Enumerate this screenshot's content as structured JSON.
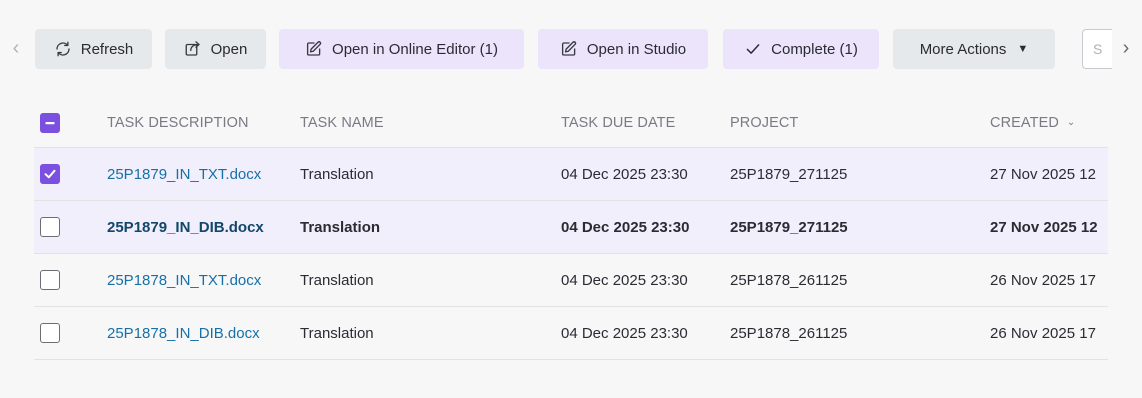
{
  "toolbar": {
    "nav_prev": "‹",
    "nav_next": "›",
    "refresh_label": "Refresh",
    "open_label": "Open",
    "open_online_editor_label": "Open in Online Editor (1)",
    "open_studio_label": "Open in Studio",
    "complete_label": "Complete (1)",
    "more_actions_label": "More Actions",
    "search_placeholder": "S"
  },
  "colors": {
    "accent_purple": "#7b4fe0",
    "button_purple_bg": "#ebe4fb",
    "button_gray_bg": "#e6e9ec",
    "link": "#1670a8",
    "selected_row_bg": "#f1effb"
  },
  "table": {
    "header_checkbox_state": "indeterminate",
    "columns": {
      "description": "TASK DESCRIPTION",
      "name": "TASK NAME",
      "due": "TASK DUE DATE",
      "project": "PROJECT",
      "created": "CREATED"
    },
    "rows": [
      {
        "checked": true,
        "bold": false,
        "description": "25P1879_IN_TXT.docx",
        "name": "Translation",
        "due": "04 Dec 2025 23:30",
        "project": "25P1879_271125",
        "created": "27 Nov 2025 12"
      },
      {
        "checked": false,
        "bold": true,
        "description": "25P1879_IN_DIB.docx",
        "name": "Translation",
        "due": "04 Dec 2025 23:30",
        "project": "25P1879_271125",
        "created": "27 Nov 2025 12"
      },
      {
        "checked": false,
        "bold": false,
        "description": "25P1878_IN_TXT.docx",
        "name": "Translation",
        "due": "04 Dec 2025 23:30",
        "project": "25P1878_261125",
        "created": "26 Nov 2025 17"
      },
      {
        "checked": false,
        "bold": false,
        "description": "25P1878_IN_DIB.docx",
        "name": "Translation",
        "due": "04 Dec 2025 23:30",
        "project": "25P1878_261125",
        "created": "26 Nov 2025 17"
      }
    ]
  }
}
